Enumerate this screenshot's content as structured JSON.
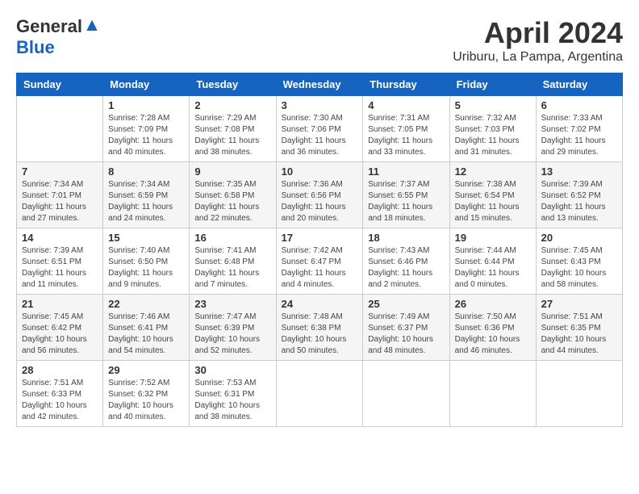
{
  "header": {
    "logo_general": "General",
    "logo_blue": "Blue",
    "month": "April 2024",
    "location": "Uriburu, La Pampa, Argentina"
  },
  "weekdays": [
    "Sunday",
    "Monday",
    "Tuesday",
    "Wednesday",
    "Thursday",
    "Friday",
    "Saturday"
  ],
  "weeks": [
    [
      {
        "day": "",
        "sunrise": "",
        "sunset": "",
        "daylight": ""
      },
      {
        "day": "1",
        "sunrise": "7:28 AM",
        "sunset": "7:09 PM",
        "daylight": "11 hours and 40 minutes."
      },
      {
        "day": "2",
        "sunrise": "7:29 AM",
        "sunset": "7:08 PM",
        "daylight": "11 hours and 38 minutes."
      },
      {
        "day": "3",
        "sunrise": "7:30 AM",
        "sunset": "7:06 PM",
        "daylight": "11 hours and 36 minutes."
      },
      {
        "day": "4",
        "sunrise": "7:31 AM",
        "sunset": "7:05 PM",
        "daylight": "11 hours and 33 minutes."
      },
      {
        "day": "5",
        "sunrise": "7:32 AM",
        "sunset": "7:03 PM",
        "daylight": "11 hours and 31 minutes."
      },
      {
        "day": "6",
        "sunrise": "7:33 AM",
        "sunset": "7:02 PM",
        "daylight": "11 hours and 29 minutes."
      }
    ],
    [
      {
        "day": "7",
        "sunrise": "7:34 AM",
        "sunset": "7:01 PM",
        "daylight": "11 hours and 27 minutes."
      },
      {
        "day": "8",
        "sunrise": "7:34 AM",
        "sunset": "6:59 PM",
        "daylight": "11 hours and 24 minutes."
      },
      {
        "day": "9",
        "sunrise": "7:35 AM",
        "sunset": "6:58 PM",
        "daylight": "11 hours and 22 minutes."
      },
      {
        "day": "10",
        "sunrise": "7:36 AM",
        "sunset": "6:56 PM",
        "daylight": "11 hours and 20 minutes."
      },
      {
        "day": "11",
        "sunrise": "7:37 AM",
        "sunset": "6:55 PM",
        "daylight": "11 hours and 18 minutes."
      },
      {
        "day": "12",
        "sunrise": "7:38 AM",
        "sunset": "6:54 PM",
        "daylight": "11 hours and 15 minutes."
      },
      {
        "day": "13",
        "sunrise": "7:39 AM",
        "sunset": "6:52 PM",
        "daylight": "11 hours and 13 minutes."
      }
    ],
    [
      {
        "day": "14",
        "sunrise": "7:39 AM",
        "sunset": "6:51 PM",
        "daylight": "11 hours and 11 minutes."
      },
      {
        "day": "15",
        "sunrise": "7:40 AM",
        "sunset": "6:50 PM",
        "daylight": "11 hours and 9 minutes."
      },
      {
        "day": "16",
        "sunrise": "7:41 AM",
        "sunset": "6:48 PM",
        "daylight": "11 hours and 7 minutes."
      },
      {
        "day": "17",
        "sunrise": "7:42 AM",
        "sunset": "6:47 PM",
        "daylight": "11 hours and 4 minutes."
      },
      {
        "day": "18",
        "sunrise": "7:43 AM",
        "sunset": "6:46 PM",
        "daylight": "11 hours and 2 minutes."
      },
      {
        "day": "19",
        "sunrise": "7:44 AM",
        "sunset": "6:44 PM",
        "daylight": "11 hours and 0 minutes."
      },
      {
        "day": "20",
        "sunrise": "7:45 AM",
        "sunset": "6:43 PM",
        "daylight": "10 hours and 58 minutes."
      }
    ],
    [
      {
        "day": "21",
        "sunrise": "7:45 AM",
        "sunset": "6:42 PM",
        "daylight": "10 hours and 56 minutes."
      },
      {
        "day": "22",
        "sunrise": "7:46 AM",
        "sunset": "6:41 PM",
        "daylight": "10 hours and 54 minutes."
      },
      {
        "day": "23",
        "sunrise": "7:47 AM",
        "sunset": "6:39 PM",
        "daylight": "10 hours and 52 minutes."
      },
      {
        "day": "24",
        "sunrise": "7:48 AM",
        "sunset": "6:38 PM",
        "daylight": "10 hours and 50 minutes."
      },
      {
        "day": "25",
        "sunrise": "7:49 AM",
        "sunset": "6:37 PM",
        "daylight": "10 hours and 48 minutes."
      },
      {
        "day": "26",
        "sunrise": "7:50 AM",
        "sunset": "6:36 PM",
        "daylight": "10 hours and 46 minutes."
      },
      {
        "day": "27",
        "sunrise": "7:51 AM",
        "sunset": "6:35 PM",
        "daylight": "10 hours and 44 minutes."
      }
    ],
    [
      {
        "day": "28",
        "sunrise": "7:51 AM",
        "sunset": "6:33 PM",
        "daylight": "10 hours and 42 minutes."
      },
      {
        "day": "29",
        "sunrise": "7:52 AM",
        "sunset": "6:32 PM",
        "daylight": "10 hours and 40 minutes."
      },
      {
        "day": "30",
        "sunrise": "7:53 AM",
        "sunset": "6:31 PM",
        "daylight": "10 hours and 38 minutes."
      },
      {
        "day": "",
        "sunrise": "",
        "sunset": "",
        "daylight": ""
      },
      {
        "day": "",
        "sunrise": "",
        "sunset": "",
        "daylight": ""
      },
      {
        "day": "",
        "sunrise": "",
        "sunset": "",
        "daylight": ""
      },
      {
        "day": "",
        "sunrise": "",
        "sunset": "",
        "daylight": ""
      }
    ]
  ]
}
